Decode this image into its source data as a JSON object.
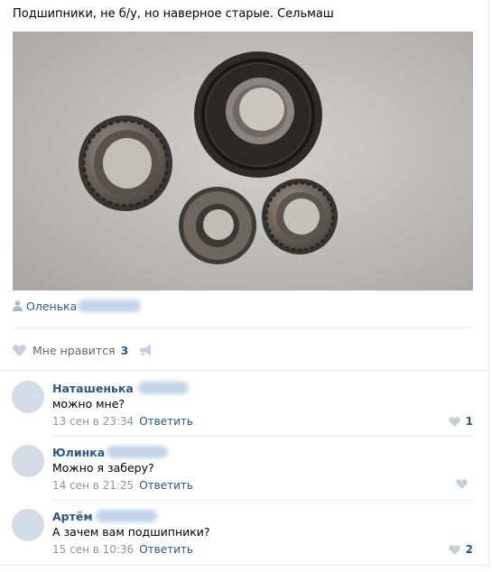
{
  "post": {
    "text": "Подшипники, не б/у, но наверное старые. Сельмаш",
    "author_name": "Оленька",
    "author_icon": "user-icon"
  },
  "actions": {
    "like_label": "Мне нравится",
    "like_count": "3",
    "like_icon": "heart-icon",
    "share_icon": "megaphone-icon"
  },
  "comments": [
    {
      "name": "Наташенька",
      "text": "можно мне?",
      "time": "13 сен в 23:34",
      "reply_label": "Ответить",
      "likes": "1"
    },
    {
      "name": "Юлинка",
      "text": "Можно я заберу?",
      "time": "14 сен в 21:25",
      "reply_label": "Ответить",
      "likes": ""
    },
    {
      "name": "Артём",
      "text": "А зачем вам подшипники?",
      "time": "15 сен в 10:36",
      "reply_label": "Ответить",
      "likes": "2"
    }
  ],
  "colors": {
    "link": "#2a5885",
    "meta": "#939393",
    "heart": "#c5d0db",
    "avatar": "#d2dbe6",
    "divider": "#e7e8ec"
  }
}
